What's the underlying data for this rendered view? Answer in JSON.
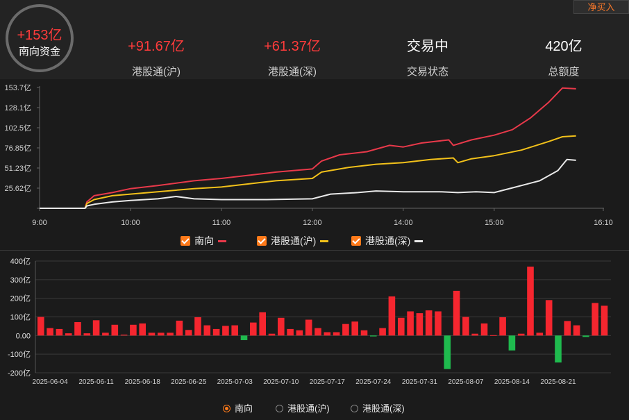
{
  "top_tag": "净买入",
  "summary": {
    "value": "+153亿",
    "label": "南向资金"
  },
  "stats": [
    {
      "value": "+91.67亿",
      "label": "港股通(沪)"
    },
    {
      "value": "+61.37亿",
      "label": "港股通(深)"
    },
    {
      "value": "交易中",
      "label": "交易状态"
    },
    {
      "value": "420亿",
      "label": "总额度"
    }
  ],
  "colors": {
    "south": "#e8394a",
    "sh": "#f2c11a",
    "sz": "#e9e9e9",
    "pos_bar": "#f5262f",
    "neg_bar": "#1fba4e",
    "accent": "#ff7a1a"
  },
  "intraday_legend": [
    {
      "label": "南向",
      "color": "#e8394a"
    },
    {
      "label": "港股通(沪)",
      "color": "#f2c11a"
    },
    {
      "label": "港股通(深)",
      "color": "#e9e9e9"
    }
  ],
  "daily_legend": [
    {
      "label": "南向",
      "selected": true
    },
    {
      "label": "港股通(沪)",
      "selected": false
    },
    {
      "label": "港股通(深)",
      "selected": false
    }
  ],
  "chart_data": [
    {
      "type": "line",
      "x_ticks": [
        "9:00",
        "10:00",
        "11:00",
        "12:00",
        "14:00",
        "15:00",
        "16:10"
      ],
      "y_ticks": [
        "153.7亿",
        "128.1亿",
        "102.5亿",
        "76.85亿",
        "51.23亿",
        "25.62亿",
        ""
      ],
      "ylim": [
        0,
        153.7
      ],
      "x_positions": [
        0,
        1,
        2,
        3,
        4,
        5,
        6.2
      ],
      "series": [
        {
          "name": "南向",
          "points": [
            [
              0,
              0
            ],
            [
              0.5,
              0
            ],
            [
              0.52,
              8
            ],
            [
              0.6,
              16
            ],
            [
              0.8,
              20
            ],
            [
              1,
              25
            ],
            [
              1.3,
              29
            ],
            [
              1.7,
              35
            ],
            [
              2,
              38
            ],
            [
              2.3,
              42
            ],
            [
              2.6,
              46
            ],
            [
              3,
              50
            ],
            [
              3.1,
              60
            ],
            [
              3.3,
              68
            ],
            [
              3.6,
              72
            ],
            [
              3.85,
              80
            ],
            [
              4,
              78
            ],
            [
              4.2,
              83
            ],
            [
              4.5,
              87
            ],
            [
              4.55,
              80
            ],
            [
              4.75,
              87
            ],
            [
              5,
              93
            ],
            [
              5.2,
              100
            ],
            [
              5.4,
              115
            ],
            [
              5.6,
              135
            ],
            [
              5.75,
              153
            ],
            [
              5.9,
              152
            ]
          ]
        },
        {
          "name": "港股通(沪)",
          "points": [
            [
              0,
              0
            ],
            [
              0.5,
              0
            ],
            [
              0.52,
              6
            ],
            [
              0.6,
              11
            ],
            [
              0.8,
              16
            ],
            [
              1,
              18
            ],
            [
              1.3,
              21
            ],
            [
              1.7,
              25
            ],
            [
              2,
              27
            ],
            [
              2.3,
              31
            ],
            [
              2.6,
              35
            ],
            [
              3,
              38
            ],
            [
              3.1,
              46
            ],
            [
              3.4,
              52
            ],
            [
              3.7,
              56
            ],
            [
              4,
              58
            ],
            [
              4.3,
              62
            ],
            [
              4.55,
              64
            ],
            [
              4.6,
              58
            ],
            [
              4.75,
              63
            ],
            [
              5,
              67
            ],
            [
              5.3,
              74
            ],
            [
              5.6,
              85
            ],
            [
              5.75,
              91
            ],
            [
              5.9,
              92
            ]
          ]
        },
        {
          "name": "港股通(深)",
          "points": [
            [
              0,
              0
            ],
            [
              0.5,
              0
            ],
            [
              0.52,
              3
            ],
            [
              0.6,
              5
            ],
            [
              0.8,
              8
            ],
            [
              1,
              10
            ],
            [
              1.3,
              12
            ],
            [
              1.5,
              15
            ],
            [
              1.7,
              12
            ],
            [
              2,
              11
            ],
            [
              2.5,
              11
            ],
            [
              3,
              12
            ],
            [
              3.2,
              18
            ],
            [
              3.5,
              20
            ],
            [
              3.7,
              22
            ],
            [
              4,
              21
            ],
            [
              4.4,
              21
            ],
            [
              4.6,
              20
            ],
            [
              4.8,
              21
            ],
            [
              5,
              20
            ],
            [
              5.2,
              26
            ],
            [
              5.5,
              35
            ],
            [
              5.7,
              48
            ],
            [
              5.8,
              62
            ],
            [
              5.9,
              61
            ]
          ]
        }
      ]
    },
    {
      "type": "bar",
      "y_ticks": [
        "400亿",
        "300亿",
        "200亿",
        "100亿",
        "0.00",
        "-100亿",
        "-200亿"
      ],
      "ylim": [
        -200,
        400
      ],
      "x_tick_labels": [
        "2025-06-04",
        "2025-06-11",
        "2025-06-18",
        "2025-06-25",
        "2025-07-03",
        "2025-07-10",
        "2025-07-17",
        "2025-07-24",
        "2025-07-31",
        "2025-08-07",
        "2025-08-14",
        "2025-08-21"
      ],
      "series": [
        {
          "name": "南向",
          "values": [
            100,
            40,
            35,
            12,
            72,
            12,
            82,
            15,
            58,
            5,
            58,
            65,
            15,
            15,
            15,
            80,
            30,
            98,
            55,
            35,
            52,
            55,
            -25,
            70,
            125,
            10,
            95,
            35,
            28,
            85,
            40,
            18,
            18,
            62,
            75,
            28,
            -5,
            40,
            210,
            95,
            130,
            120,
            135,
            130,
            -180,
            240,
            100,
            10,
            65,
            2,
            98,
            -80,
            10,
            370,
            15,
            190,
            -145,
            78,
            55,
            -8,
            175,
            160
          ]
        }
      ]
    }
  ]
}
